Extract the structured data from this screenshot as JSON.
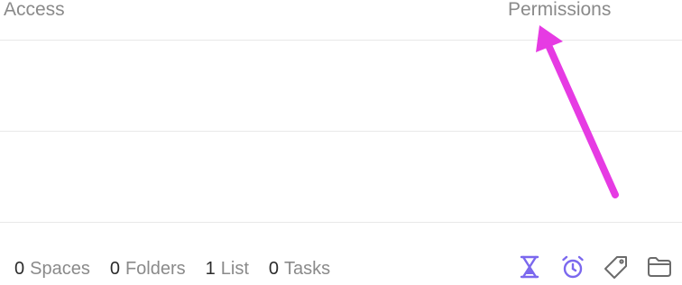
{
  "header": {
    "access_label": "Access",
    "permissions_label": "Permissions"
  },
  "footer": {
    "stats": [
      {
        "count": "0",
        "label": "Spaces"
      },
      {
        "count": "0",
        "label": "Folders"
      },
      {
        "count": "1",
        "label": "List"
      },
      {
        "count": "0",
        "label": "Tasks"
      }
    ],
    "icons": [
      "hourglass-icon",
      "stopwatch-icon",
      "tag-icon",
      "folder-icon"
    ]
  },
  "colors": {
    "accent": "#7b68ee",
    "annotation_arrow": "#e63be3",
    "muted_text": "#8a8a8a",
    "divider": "#e8e8e8"
  }
}
